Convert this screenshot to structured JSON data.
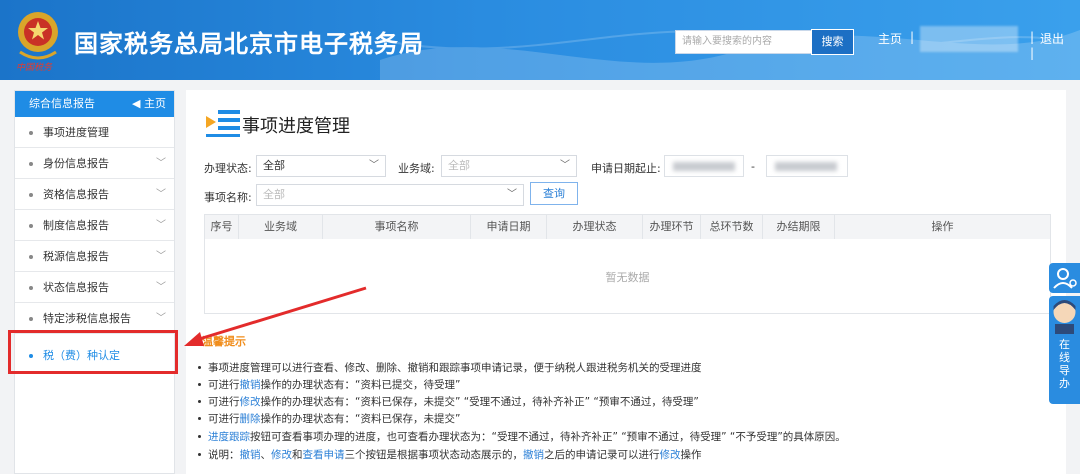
{
  "header": {
    "title": "国家税务总局北京市电子税务局",
    "emblem_caption": "中国税务",
    "search_placeholder": "请输入要搜索的内容",
    "search_button": "搜索",
    "home": "主页",
    "separator": "|",
    "logout": "退出"
  },
  "sidebar": {
    "header_label": "综合信息报告",
    "home_link": "主页",
    "items": [
      {
        "label": "事项进度管理",
        "expandable": false
      },
      {
        "label": "身份信息报告",
        "expandable": true
      },
      {
        "label": "资格信息报告",
        "expandable": true
      },
      {
        "label": "制度信息报告",
        "expandable": true
      },
      {
        "label": "税源信息报告",
        "expandable": true
      },
      {
        "label": "状态信息报告",
        "expandable": true
      },
      {
        "label": "特定涉税信息报告",
        "expandable": true
      },
      {
        "label": "税（费）种认定",
        "expandable": false
      }
    ]
  },
  "main": {
    "page_title": "事项进度管理",
    "filters": {
      "status_label": "办理状态:",
      "status_value": "全部",
      "domain_label": "业务域:",
      "domain_value": "全部",
      "date_label": "申请日期起止:",
      "date_separator": "-",
      "item_label": "事项名称:",
      "item_value": "全部",
      "query_button": "查询"
    },
    "table": {
      "columns": [
        "序号",
        "业务域",
        "事项名称",
        "申请日期",
        "办理状态",
        "办理环节",
        "总环节数",
        "办结期限",
        "操作"
      ],
      "empty_text": "暂无数据"
    },
    "tips": {
      "title": "温馨提示",
      "line1": "事项进度管理可以进行查看、修改、删除、撤销和跟踪事项申请记录，便于纳税人跟进税务机关的受理进度",
      "line2_pre": "可进行",
      "line2_link": "撤销",
      "line2_post": "操作的办理状态有：“资料已提交，待受理”",
      "line3_pre": "可进行",
      "line3_link": "修改",
      "line3_post": "操作的办理状态有：“资料已保存，未提交”  “受理不通过，待补齐补正”  “预审不通过，待受理”",
      "line4_pre": "可进行",
      "line4_link": "删除",
      "line4_post": "操作的办理状态有：“资料已保存，未提交”",
      "line5_link": "进度跟踪",
      "line5_post": "按钮可查看事项办理的进度，也可查看办理状态为：“受理不通过，待补齐补正”  “预审不通过，待受理”  “不予受理”的具体原因。",
      "line6_pre": "说明：",
      "line6_link1": "撤销",
      "line6_mid1": "、",
      "line6_link2": "修改",
      "line6_mid2": "和",
      "line6_link3": "查看申请",
      "line6_mid3": "三个按钮是根据事项状态动态展示的，",
      "line6_link4": "撤销",
      "line6_mid4": "之后的申请记录可以进行",
      "line6_link5": "修改",
      "line6_post": "操作"
    }
  },
  "float": {
    "guide_text": "在线导办"
  },
  "colors": {
    "header_blue": "#1b74c9",
    "sidebar_blue": "#1f8ce5",
    "link_blue": "#2a7fd6",
    "annotation_red": "#e32b2b",
    "tips_orange": "#f08c1a"
  }
}
